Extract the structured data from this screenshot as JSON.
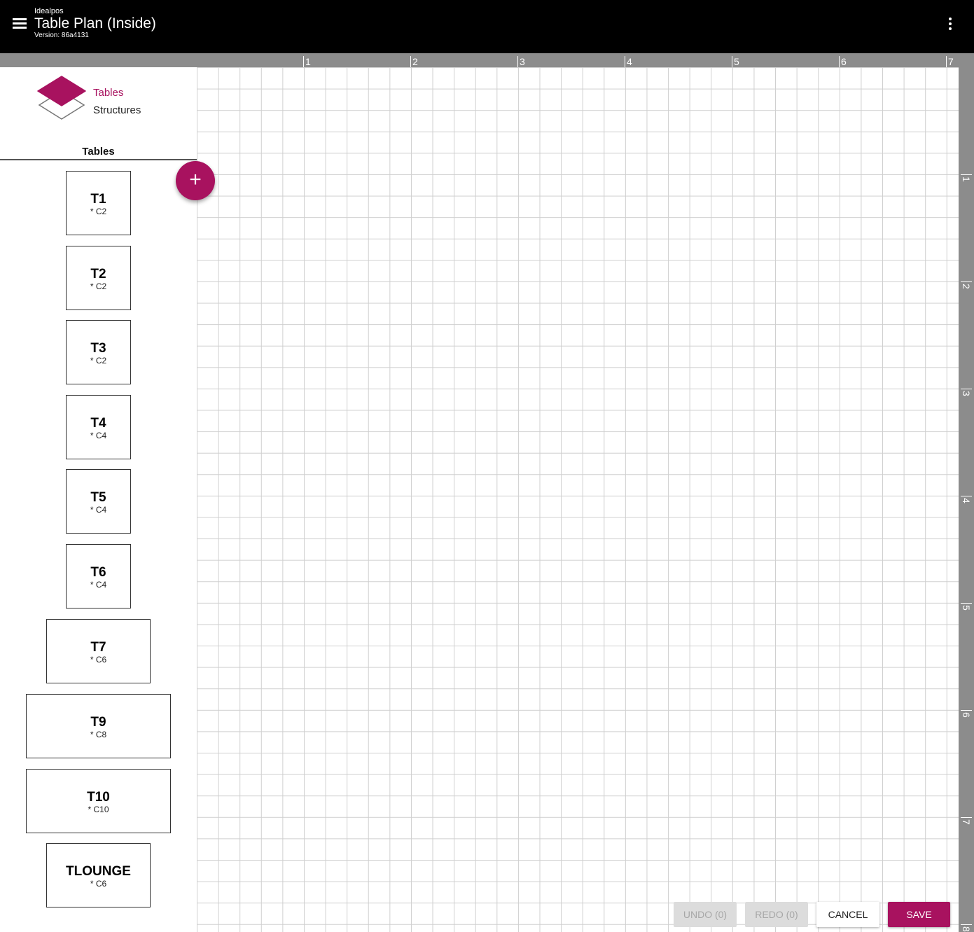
{
  "app": {
    "name": "Idealpos",
    "title": "Table Plan (Inside)",
    "version": "Version: 86a4131"
  },
  "icons": {
    "menu": "menu-icon",
    "more": "more-vert-icon",
    "layers": "layers-icon",
    "add": "add-icon"
  },
  "colors": {
    "accent": "#a8125f",
    "appbar": "#000000",
    "ruler": "#8c8c8c",
    "grid_line": "#cfcfcf"
  },
  "left_panel": {
    "tabs": [
      {
        "label": "Tables",
        "active": true
      },
      {
        "label": "Structures",
        "active": false
      }
    ],
    "section_title": "Tables",
    "tables": [
      {
        "name": "T1",
        "capacity": "* C2"
      },
      {
        "name": "T2",
        "capacity": "* C2"
      },
      {
        "name": "T3",
        "capacity": "* C2"
      },
      {
        "name": "T4",
        "capacity": "* C4"
      },
      {
        "name": "T5",
        "capacity": "* C4"
      },
      {
        "name": "T6",
        "capacity": "* C4"
      },
      {
        "name": "T7",
        "capacity": "* C6"
      },
      {
        "name": "T9",
        "capacity": "* C8"
      },
      {
        "name": "T10",
        "capacity": "* C10"
      },
      {
        "name": "TLOUNGE",
        "capacity": "* C6"
      }
    ]
  },
  "add_button_label": "+",
  "rulers": {
    "top": [
      "1",
      "2",
      "3",
      "4",
      "5",
      "6",
      "7"
    ],
    "right": [
      "1",
      "2",
      "3",
      "4",
      "5",
      "6",
      "7",
      "8"
    ]
  },
  "actions": {
    "undo": "UNDO (0)",
    "redo": "REDO (0)",
    "cancel": "CANCEL",
    "save": "SAVE"
  }
}
